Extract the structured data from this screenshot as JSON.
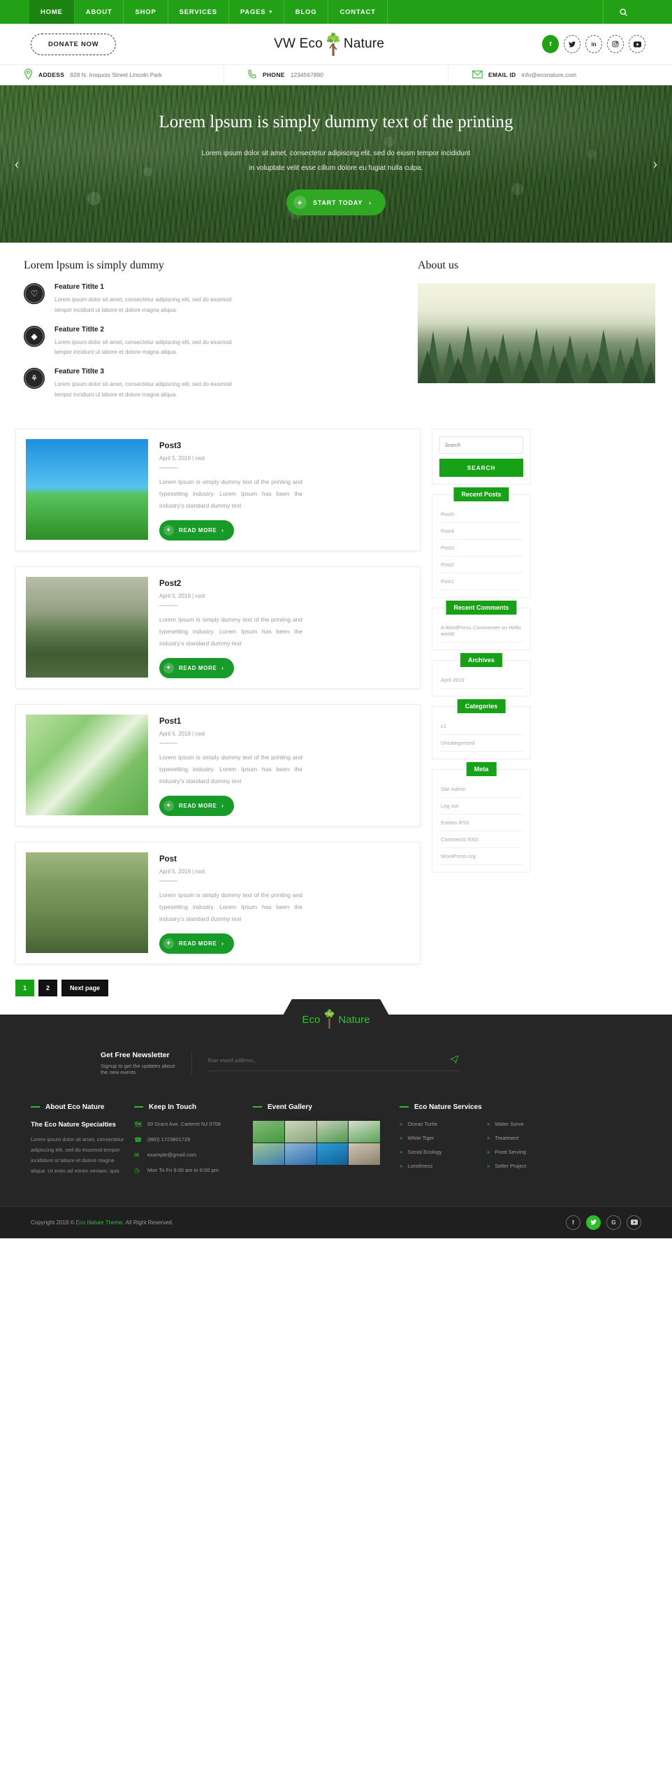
{
  "nav": {
    "items": [
      {
        "label": "HOME",
        "active": true
      },
      {
        "label": "ABOUT",
        "active": false
      },
      {
        "label": "SHOP",
        "active": false
      },
      {
        "label": "SERVICES",
        "active": false
      },
      {
        "label": "PAGES",
        "active": false,
        "caret": "⌄"
      },
      {
        "label": "BLOG",
        "active": false
      },
      {
        "label": "CONTACT",
        "active": false
      }
    ],
    "search_icon": "search-icon"
  },
  "header": {
    "donate_label": "DONATE NOW",
    "logo_part1": "VW Eco",
    "logo_part2": "Nature",
    "social": [
      {
        "name": "facebook",
        "glyph": "f",
        "active": true
      },
      {
        "name": "twitter",
        "glyph": "🐦",
        "active": false
      },
      {
        "name": "linkedin",
        "glyph": "in",
        "active": false
      },
      {
        "name": "instagram",
        "glyph": "▣",
        "active": false
      },
      {
        "name": "youtube",
        "glyph": "▶",
        "active": false
      }
    ]
  },
  "contactbar": {
    "address_label": "ADDESS",
    "address_value": "828 N. Iroquois Street Lincoln Park",
    "phone_label": "PHONE",
    "phone_value": "1234567890",
    "email_label": "EMAIL ID",
    "email_value": "info@econature.com"
  },
  "hero": {
    "heading": "Lorem lpsum is simply dummy text of the printing",
    "line1": "Lorem ipsum dolor sit amet, consectetur adipiscing elit, sed do eiusm tempor incididunt",
    "line2": "in voluptate velit esse cillum dolore eu fugiat nulla culpa.",
    "button": "START TODAY",
    "prev": "‹",
    "next": "›"
  },
  "features": {
    "section_title": "Lorem lpsum is simply dummy",
    "items": [
      {
        "icon": "heart-icon",
        "glyph": "♡",
        "title": "Feature Titlte 1",
        "text": "Lorem ipsum dolor sit amet, consectetur adipiscing elit, sed do eiusmod tempor incidiunt ut labore et dolore magna aliqua."
      },
      {
        "icon": "diamond-icon",
        "glyph": "◆",
        "title": "Feature Titlte 2",
        "text": "Lorem ipsum dolor sit amet, consectetur adipiscing elit, sed do eiusmod tempor incidiunt ut labore et dolore magna aliqua."
      },
      {
        "icon": "leaf-icon",
        "glyph": "⚘",
        "title": "Feature Titlte 3",
        "text": "Lorem ipsum dolor sit amet, consectetur adipiscing elit, sed do eiusmod tempor incidiunt ut labore et dolore magna aliqua."
      }
    ]
  },
  "about": {
    "title": "About us"
  },
  "posts": {
    "read_more": "READ MORE",
    "items": [
      {
        "title": "Post3",
        "meta": "April 5, 2019 |  root",
        "text": "Lorem Ipsum is simply dummy text of the printing and typesetting industry. Lorem Ipsum has been the industry’s standard dummy text"
      },
      {
        "title": "Post2",
        "meta": "April 5, 2019 |  root",
        "text": "Lorem Ipsum is simply dummy text of the printing and typesetting industry. Lorem Ipsum has been the industry’s standard dummy text"
      },
      {
        "title": "Post1",
        "meta": "April 5, 2019 |  root",
        "text": "Lorem Ipsum is simply dummy text of the printing and typesetting industry. Lorem Ipsum has been the industry’s standard dummy text"
      },
      {
        "title": "Post",
        "meta": "April 5, 2019 |  root",
        "text": "Lorem Ipsum is simply dummy text of the printing and typesetting industry. Lorem Ipsum has been the industry’s standard dummy text"
      }
    ]
  },
  "pagination": {
    "page1": "1",
    "page2": "2",
    "next": "Next page"
  },
  "sidebar": {
    "search_placeholder": "Search",
    "search_button": "SEARCH",
    "recent_posts_title": "Recent Posts",
    "recent_posts": [
      "Post5",
      "Post4",
      "Post3",
      "Post2",
      "Post1"
    ],
    "recent_comments_title": "Recent Comments",
    "recent_comments": [
      "A WordPress Commenter on Hello world!"
    ],
    "archives_title": "Archives",
    "archives": [
      "April 2019"
    ],
    "categories_title": "Categories",
    "categories": [
      "c1",
      "Uncategorized"
    ],
    "meta_title": "Meta",
    "meta": [
      "Site Admin",
      "Log out",
      "Entries RSS",
      "Comments RSS",
      "WordPress.org"
    ]
  },
  "footer": {
    "logo_part1": "Eco",
    "logo_part2": "Nature",
    "newsletter_title": "Get Free Newsletter",
    "newsletter_sub": "Signup to get the updates about the new events",
    "newsletter_placeholder": "Your email address...",
    "col_about_title": "About Eco Nature",
    "col_about_sub": "The Eco Nature Specialties",
    "col_about_text": "Lorem ipsum dolor sit amet, consectetur adipiscing elit, sed do eiusmod tempor incididunt ut labore et dolore magna aliqua. Ut enim ad minim veniam, quis",
    "col_touch_title": "Keep In Touch",
    "contacts": [
      {
        "icon": "map-icon",
        "glyph": "🗺",
        "text": "60 Grant Ave. Carteret NJ 0708"
      },
      {
        "icon": "phone-icon",
        "glyph": "☎",
        "text": "(880) 1723801729"
      },
      {
        "icon": "mail-icon",
        "glyph": "✉",
        "text": "example@gmail.com"
      },
      {
        "icon": "clock-icon",
        "glyph": "◴",
        "text": "Mon To Fri 9:00 am to 6:00 pm"
      }
    ],
    "col_gallery_title": "Event Gallery",
    "col_services_title": "Eco Nature Services",
    "services": [
      "Ocean Turtle",
      "Water Surve",
      "White Tiger",
      "Treatment",
      "Social Ecology",
      "Food Serving",
      "Loneliness",
      "Selter Project"
    ],
    "copyright_pre": "Copyright 2019 © ",
    "copyright_link": "Eco Nature Theme",
    "copyright_post": ". All Right Reserved.",
    "copy_social": [
      {
        "name": "facebook",
        "glyph": "f",
        "active": false
      },
      {
        "name": "twitter",
        "glyph": "🐦",
        "active": true
      },
      {
        "name": "google",
        "glyph": "G",
        "active": false
      },
      {
        "name": "youtube",
        "glyph": "▶",
        "active": false
      }
    ]
  },
  "colors": {
    "brand_green": "#22a116",
    "accent_green": "#17a117",
    "dark": "#262626"
  }
}
